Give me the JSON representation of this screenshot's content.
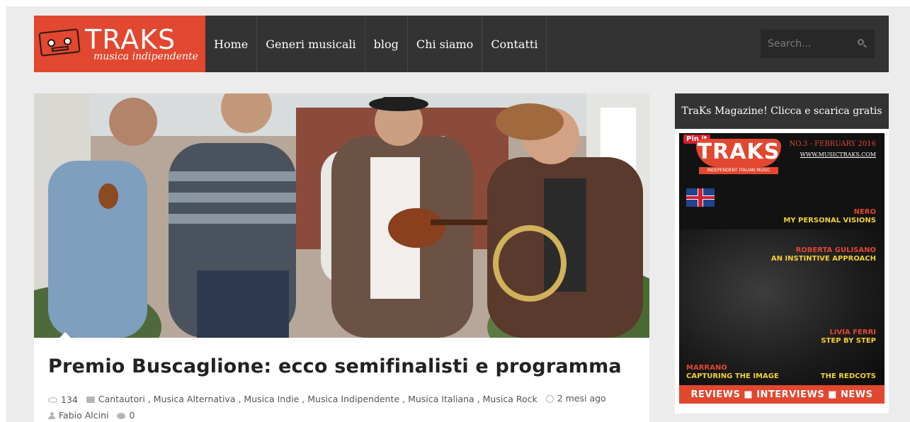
{
  "header": {
    "logo": {
      "title": "TRAKS",
      "tagline": "musica indipendente"
    },
    "nav": [
      {
        "label": "Home"
      },
      {
        "label": "Generi musicali"
      },
      {
        "label": "blog"
      },
      {
        "label": "Chi siamo"
      },
      {
        "label": "Contatti"
      }
    ],
    "search": {
      "placeholder": "Search...",
      "icon": "search-icon"
    }
  },
  "post": {
    "title": "Premio Buscaglione: ecco semifinalisti e programma",
    "views": "134",
    "categories": [
      "Cantautori",
      "Musica Alternativa",
      "Musica Indie",
      "Musica Indipendente",
      "Musica Italiana",
      "Musica Rock"
    ],
    "time_ago": "2 mesi ago",
    "author": "Fabio Alcini",
    "comments": "0"
  },
  "sidebar": {
    "title": "TraKs Magazine! Clicca e scarica gratis",
    "magazine": {
      "pin_label": "Pin it",
      "logo": "TRAKS",
      "subtitle": "INDEPENDENT ITALIAN MUSIC",
      "issue": "NO.3 - FEBRUARY 2016",
      "site": "WWW.MUSICTRAKS.COM",
      "headlines": [
        {
          "name": "NERO",
          "subtitle": "MY PERSONAL VISIONS"
        },
        {
          "name": "ROBERTA GULISANO",
          "subtitle": "AN INSTINTIVE APPROACH"
        },
        {
          "name": "LIVIA FERRI",
          "subtitle": "STEP BY STEP"
        },
        {
          "name": "MARRANO",
          "subtitle": "CAPTURING THE IMAGE"
        },
        {
          "name": "",
          "subtitle": "THE REDCOTS"
        }
      ],
      "footer": "REVIEWS ■ INTERVIEWS ■ NEWS"
    }
  },
  "colors": {
    "brand": "#e2472f",
    "dark": "#333333",
    "background": "#ececec"
  }
}
